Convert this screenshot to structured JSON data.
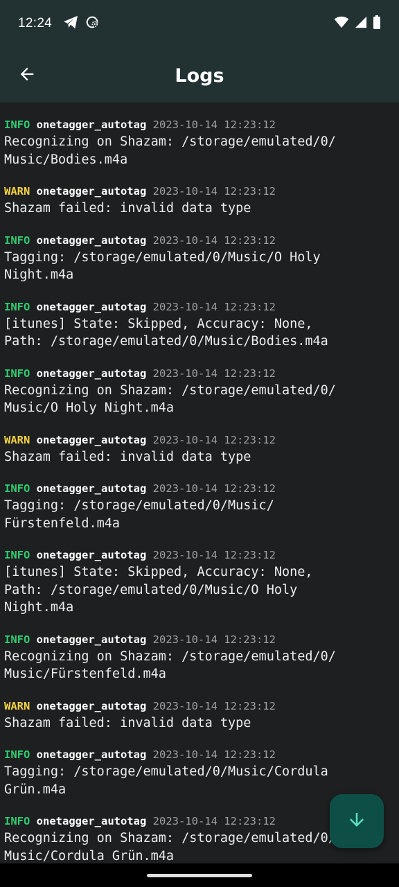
{
  "status_bar": {
    "time": "12:24",
    "left_icons": [
      "telegram-icon",
      "sync-settings-icon"
    ],
    "right_icons": [
      "wifi-icon",
      "signal-icon",
      "battery-icon"
    ]
  },
  "app_bar": {
    "title": "Logs",
    "back_icon": "arrow-back-icon"
  },
  "colors": {
    "info": "#2ecc71",
    "warn": "#f5d442",
    "header_bg": "#223132",
    "fab_bg": "#0d4f46"
  },
  "logs": [
    {
      "level": "INFO",
      "module": "onetagger_autotag",
      "timestamp": "2023-10-14 12:23:12",
      "lines": [
        "Recognizing on Shazam: /storage/emulated/0/",
        "Music/Bodies.m4a"
      ]
    },
    {
      "level": "WARN",
      "module": "onetagger_autotag",
      "timestamp": "2023-10-14 12:23:12",
      "lines": [
        "Shazam failed: invalid data type"
      ]
    },
    {
      "level": "INFO",
      "module": "onetagger_autotag",
      "timestamp": "2023-10-14 12:23:12",
      "lines": [
        "Tagging: /storage/emulated/0/Music/O Holy",
        "Night.m4a"
      ]
    },
    {
      "level": "INFO",
      "module": "onetagger_autotag",
      "timestamp": "2023-10-14 12:23:12",
      "lines": [
        "[itunes] State: Skipped, Accuracy: None,",
        "Path: /storage/emulated/0/Music/Bodies.m4a"
      ]
    },
    {
      "level": "INFO",
      "module": "onetagger_autotag",
      "timestamp": "2023-10-14 12:23:12",
      "lines": [
        "Recognizing on Shazam: /storage/emulated/0/",
        "Music/O Holy Night.m4a"
      ]
    },
    {
      "level": "WARN",
      "module": "onetagger_autotag",
      "timestamp": "2023-10-14 12:23:12",
      "lines": [
        "Shazam failed: invalid data type"
      ]
    },
    {
      "level": "INFO",
      "module": "onetagger_autotag",
      "timestamp": "2023-10-14 12:23:12",
      "lines": [
        "Tagging: /storage/emulated/0/Music/",
        "Fürstenfeld.m4a"
      ]
    },
    {
      "level": "INFO",
      "module": "onetagger_autotag",
      "timestamp": "2023-10-14 12:23:12",
      "lines": [
        "[itunes] State: Skipped, Accuracy: None,",
        "Path: /storage/emulated/0/Music/O Holy",
        "Night.m4a"
      ]
    },
    {
      "level": "INFO",
      "module": "onetagger_autotag",
      "timestamp": "2023-10-14 12:23:12",
      "lines": [
        "Recognizing on Shazam: /storage/emulated/0/",
        "Music/Fürstenfeld.m4a"
      ]
    },
    {
      "level": "WARN",
      "module": "onetagger_autotag",
      "timestamp": "2023-10-14 12:23:12",
      "lines": [
        "Shazam failed: invalid data type"
      ]
    },
    {
      "level": "INFO",
      "module": "onetagger_autotag",
      "timestamp": "2023-10-14 12:23:12",
      "lines": [
        "Tagging: /storage/emulated/0/Music/Cordula",
        "Grün.m4a"
      ]
    },
    {
      "level": "INFO",
      "module": "onetagger_autotag",
      "timestamp": "2023-10-14 12:23:12",
      "lines": [
        "Recognizing on Shazam: /storage/emulated/0/",
        "Music/Cordula Grün.m4a"
      ]
    }
  ],
  "fab": {
    "icon": "arrow-down-icon"
  }
}
